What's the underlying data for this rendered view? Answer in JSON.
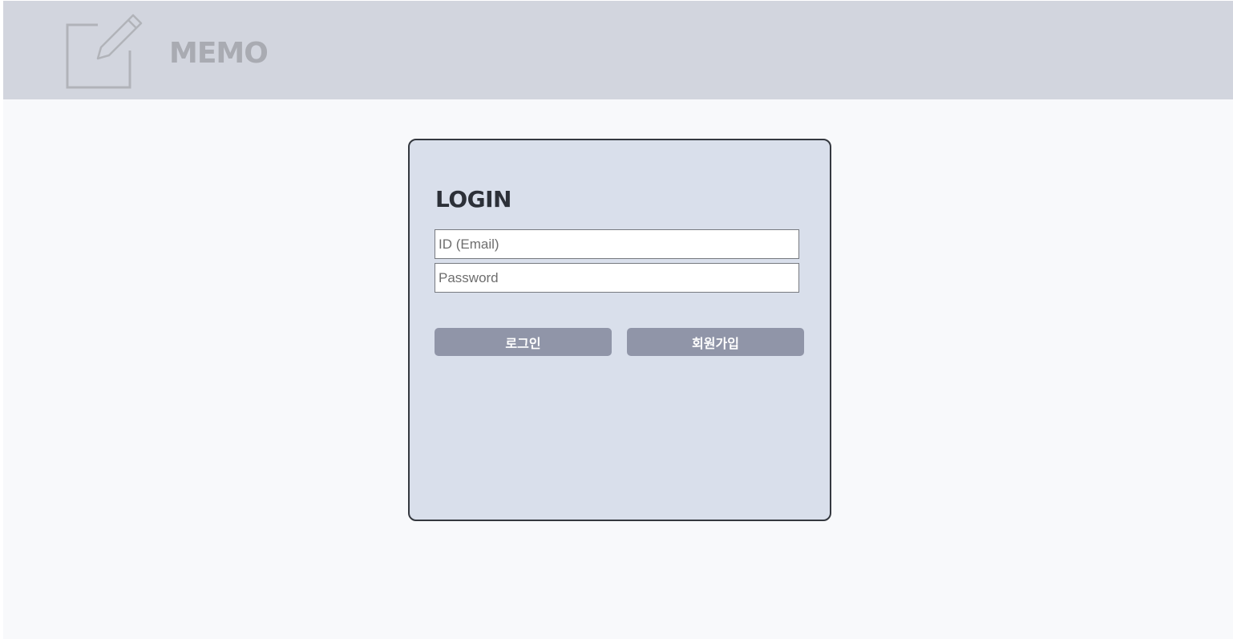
{
  "header": {
    "logo_icon": "edit-note-icon",
    "title": "MEMO"
  },
  "login": {
    "title": "LOGIN",
    "id_field": {
      "value": "",
      "placeholder": "ID (Email)"
    },
    "password_field": {
      "value": "",
      "placeholder": "Password"
    },
    "login_button": "로그인",
    "signup_button": "회원가입"
  },
  "colors": {
    "header_bg": "#d2d5de",
    "page_bg": "#f8f9fb",
    "card_bg": "#d9dfeb",
    "card_border": "#34383f",
    "button_bg": "#9095a8",
    "logo_color": "#a9abb2"
  }
}
